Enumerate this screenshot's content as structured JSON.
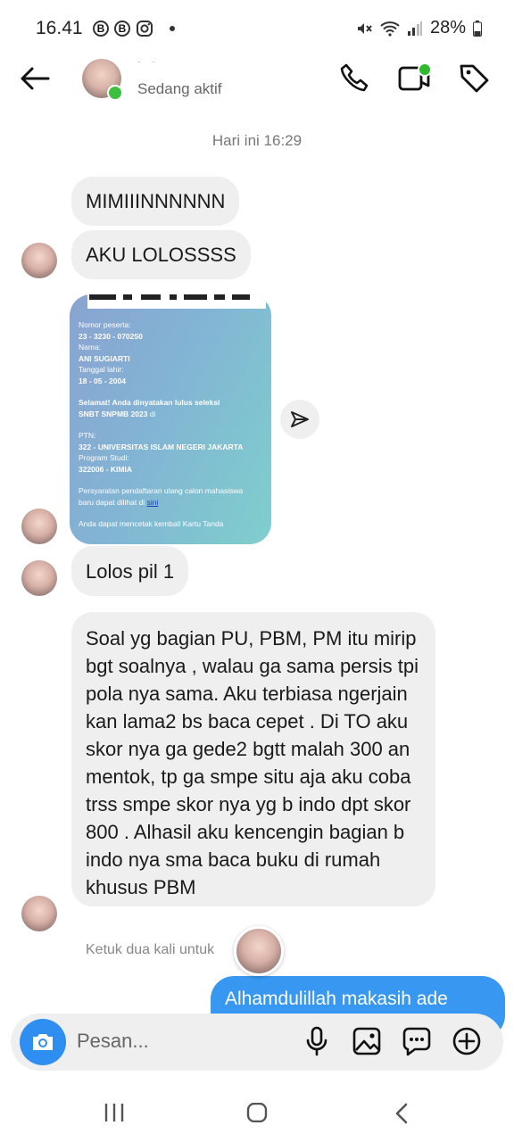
{
  "status_bar": {
    "time": "16.41",
    "icon_b1": "B",
    "icon_b2": "B",
    "battery": "28%"
  },
  "header": {
    "name": "˙ ˙",
    "status": "Sedang aktif"
  },
  "day_stamp": "Hari ini 16:29",
  "messages": [
    {
      "text": "MIMIIINNNNNN"
    },
    {
      "text": "AKU LOLOSSSS"
    },
    {
      "text": "Lolos pil 1"
    },
    {
      "text": "Soal yg bagian PU, PBM, PM  itu mirip bgt soalnya , walau ga sama persis tpi pola nya sama. Aku terbiasa ngerjain kan lama2 bs baca cepet . Di TO aku skor nya ga gede2 bgtt malah 300 an mentok, tp ga smpe situ aja aku coba trss smpe skor nya yg b indo dpt skor 800 . Alhasil aku kencengin bagian b indo nya sma baca buku di rumah khusus PBM"
    }
  ],
  "shared_card": {
    "nomor_label": "Nomor peserta:",
    "nomor_value": "23 - 3230 - 070250",
    "nama_label": "Nama:",
    "nama_value": "ANI SUGIARTI",
    "tgl_label": "Tanggal lahir:",
    "tgl_value": "18 - 05 - 2004",
    "selamat_1": "Selamat! Anda dinyatakan lulus seleksi",
    "selamat_2": "SNBT SNPMB 2023",
    "selamat_3": " di",
    "ptn_label": "PTN:",
    "ptn_value": "322 - UNIVERSITAS ISLAM NEGERI JAKARTA",
    "prodi_label": "Program Studi:",
    "prodi_value": "322006 - KIMIA",
    "persyaratan_1": "Persyaratan pendaftaran ulang calon mahasiswa",
    "persyaratan_2": "baru dapat dilihat di ",
    "link_text": "sini",
    "cetak": "Anda dapat mencetak kembali Kartu Tanda"
  },
  "hint": "Ketuk dua kali untuk",
  "sent_message": "Alhamdulillah makasih ade",
  "composer": {
    "placeholder": "Pesan..."
  },
  "colors": {
    "accent_blue": "#3897f0",
    "online_green": "#3fbf3f",
    "bubble_grey": "#efefef"
  }
}
